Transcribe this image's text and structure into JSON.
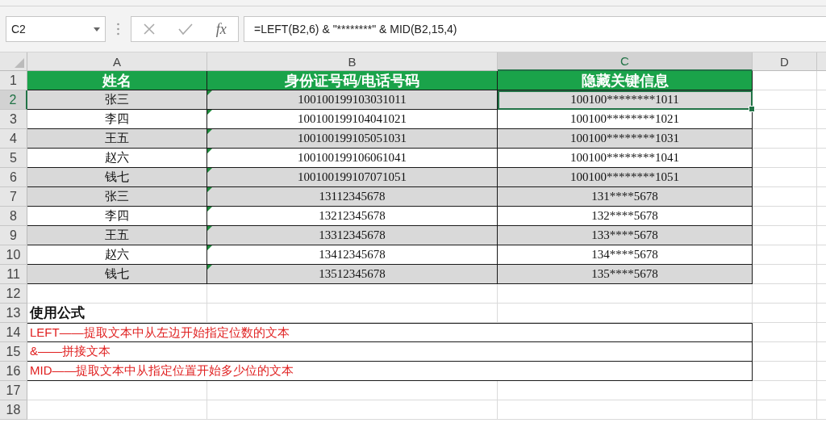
{
  "name_box": "C2",
  "function_label": "fx",
  "formula": "=LEFT(B2,6) & \"********\" & MID(B2,15,4)",
  "columns": [
    {
      "label": "A",
      "selected": false
    },
    {
      "label": "B",
      "selected": false
    },
    {
      "label": "C",
      "selected": true
    },
    {
      "label": "D",
      "selected": false
    }
  ],
  "sheet_rows": [
    {
      "kind": "header",
      "number": "1",
      "cells": [
        "姓名",
        "身份证号码/电话号码",
        "隐藏关键信息"
      ]
    },
    {
      "kind": "data",
      "number": "2",
      "name": "张三",
      "id": "100100199103031011",
      "masked": "100100********1011",
      "shaded": true,
      "selected": true,
      "text_flag": true
    },
    {
      "kind": "data",
      "number": "3",
      "name": "李四",
      "id": "100100199104041021",
      "masked": "100100********1021",
      "shaded": false,
      "selected": false,
      "text_flag": true
    },
    {
      "kind": "data",
      "number": "4",
      "name": "王五",
      "id": "100100199105051031",
      "masked": "100100********1031",
      "shaded": true,
      "selected": false,
      "text_flag": true
    },
    {
      "kind": "data",
      "number": "5",
      "name": "赵六",
      "id": "100100199106061041",
      "masked": "100100********1041",
      "shaded": false,
      "selected": false,
      "text_flag": true
    },
    {
      "kind": "data",
      "number": "6",
      "name": "钱七",
      "id": "100100199107071051",
      "masked": "100100********1051",
      "shaded": true,
      "selected": false,
      "text_flag": true
    },
    {
      "kind": "data",
      "number": "7",
      "name": "张三",
      "id": "13112345678",
      "masked": "131****5678",
      "shaded": true,
      "selected": false,
      "text_flag": true
    },
    {
      "kind": "data",
      "number": "8",
      "name": "李四",
      "id": "13212345678",
      "masked": "132****5678",
      "shaded": false,
      "selected": false,
      "text_flag": true
    },
    {
      "kind": "data",
      "number": "9",
      "name": "王五",
      "id": "13312345678",
      "masked": "133****5678",
      "shaded": true,
      "selected": false,
      "text_flag": true
    },
    {
      "kind": "data",
      "number": "10",
      "name": "赵六",
      "id": "13412345678",
      "masked": "134****5678",
      "shaded": false,
      "selected": false,
      "text_flag": true
    },
    {
      "kind": "data",
      "number": "11",
      "name": "钱七",
      "id": "13512345678",
      "masked": "135****5678",
      "shaded": true,
      "selected": false,
      "text_flag": true
    },
    {
      "kind": "blank",
      "number": "12"
    },
    {
      "kind": "title",
      "number": "13",
      "text": "使用公式"
    },
    {
      "kind": "note",
      "number": "14",
      "text": "LEFT——提取文本中从左边开始指定位数的文本"
    },
    {
      "kind": "note",
      "number": "15",
      "text": "&——拼接文本"
    },
    {
      "kind": "note",
      "number": "16",
      "text": "MID——提取文本中从指定位置开始多少位的文本"
    },
    {
      "kind": "blank",
      "number": "17"
    },
    {
      "kind": "blank",
      "number": "18"
    }
  ]
}
